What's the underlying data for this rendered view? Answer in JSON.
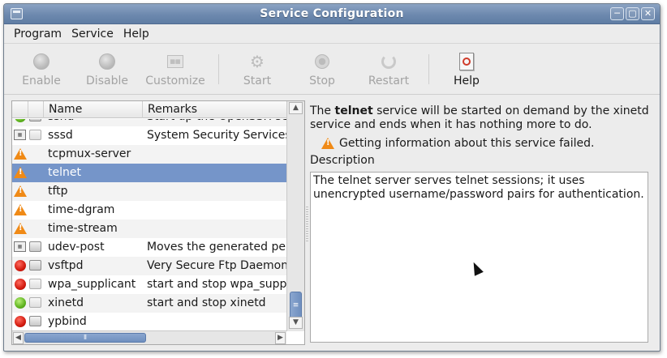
{
  "window": {
    "title": "Service Configuration",
    "controls": {
      "minimize": "─",
      "maximize": "▢",
      "close": "✕"
    }
  },
  "menu": [
    "Program",
    "Service",
    "Help"
  ],
  "toolbar": {
    "enable": "Enable",
    "disable": "Disable",
    "customize": "Customize",
    "start": "Start",
    "stop": "Stop",
    "restart": "Restart",
    "help": "Help"
  },
  "list": {
    "columns": {
      "name": "Name",
      "remarks": "Remarks"
    },
    "rows": [
      {
        "name": "sshd",
        "remark": "Start up the OpenSSH serv",
        "status": "green",
        "boot": "plug"
      },
      {
        "name": "sssd",
        "remark": "System Security Services",
        "status": "xinetd",
        "boot": "plug-gray"
      },
      {
        "name": "tcpmux-server",
        "remark": "",
        "status": "warning",
        "boot": ""
      },
      {
        "name": "telnet",
        "remark": "",
        "status": "warning",
        "boot": "",
        "selected": true
      },
      {
        "name": "tftp",
        "remark": "",
        "status": "warning",
        "boot": ""
      },
      {
        "name": "time-dgram",
        "remark": "",
        "status": "warning",
        "boot": ""
      },
      {
        "name": "time-stream",
        "remark": "",
        "status": "warning",
        "boot": ""
      },
      {
        "name": "udev-post",
        "remark": "Moves the generated pers",
        "status": "xinetd",
        "boot": "plug"
      },
      {
        "name": "vsftpd",
        "remark": "Very Secure Ftp Daemon",
        "status": "red",
        "boot": "plug"
      },
      {
        "name": "wpa_supplicant",
        "remark": "start and stop wpa_supplic",
        "status": "red",
        "boot": "plug-gray"
      },
      {
        "name": "xinetd",
        "remark": "start and stop xinetd",
        "status": "green",
        "boot": "plug-gray"
      },
      {
        "name": "ypbind",
        "remark": "",
        "status": "red",
        "boot": "plug"
      }
    ]
  },
  "detail": {
    "info_pre": "The ",
    "info_service": "telnet",
    "info_post": " service will be started on demand by the xinetd service and ends when it has nothing more to do.",
    "warning": "Getting information about this service failed.",
    "description_label": "Description",
    "description": "The telnet server serves telnet sessions; it uses unencrypted username/password pairs for authentication."
  },
  "scrollbar": {
    "up": "▲",
    "down": "▼",
    "left": "◀",
    "right": "▶",
    "grip_v": "≡",
    "grip_h": "⦀"
  }
}
